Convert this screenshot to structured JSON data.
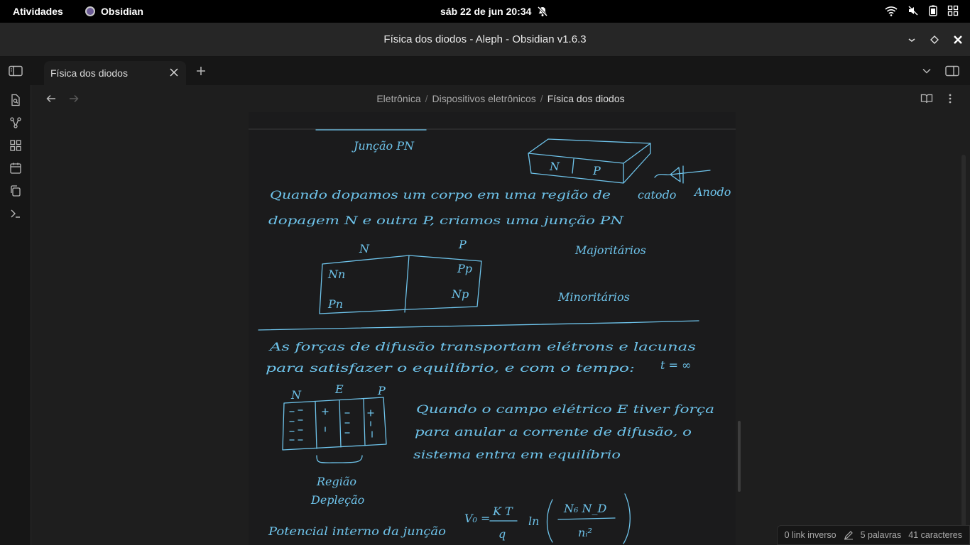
{
  "topbar": {
    "activities": "Atividades",
    "app_name": "Obsidian",
    "clock": "sáb 22 de jun  20:34"
  },
  "window": {
    "title": "Física dos diodos - Aleph - Obsidian v1.6.3"
  },
  "tabs": [
    {
      "label": "Física dos diodos"
    }
  ],
  "breadcrumb": {
    "items": [
      "Eletrônica",
      "Dispositivos eletrônicos",
      "Física dos diodos"
    ],
    "separator": "/"
  },
  "note": {
    "handwriting": {
      "heading": "Junção PN",
      "line1": "Quando dopamos um corpo em uma região de",
      "line2": "dopagem N e outra P, criamos uma junção PN",
      "catodo": "catodo",
      "anodo": "Anodo",
      "bar_n": "N",
      "bar_p": "P",
      "dia1_n": "N",
      "dia1_p": "P",
      "nn": "Nn",
      "pp": "Pp",
      "pn": "Pn",
      "np": "Np",
      "majoritarios": "Majoritários",
      "minoritarios": "Minoritários",
      "line3": "As forças de difusão transportam elétrons e lacunas",
      "line4": "para satisfazer o equilíbrio, e com o tempo:",
      "t_inf": "t = ∞",
      "dia2_n": "N",
      "dia2_e": "E",
      "dia2_p": "P",
      "para1": "Quando o campo elétrico E tiver força",
      "para2": "para anular a corrente de difusão, o",
      "para3": "sistema entra em equilíbrio",
      "regiao1": "Região",
      "regiao2": "Depleção",
      "potencial": "Potencial interno da junção",
      "formula_v": "V₀ =",
      "formula_kt": "K T",
      "formula_q": "q",
      "formula_ln": "ln",
      "formula_num": "N₆ N_D",
      "formula_den": "nᵢ²"
    }
  },
  "status": {
    "backlinks": "0 link inverso",
    "words": "5 palavras",
    "chars": "41 caracteres"
  },
  "colors": {
    "ink": "#6ec3ea",
    "bg": "#1e1e1e",
    "topbar": "#000000"
  }
}
